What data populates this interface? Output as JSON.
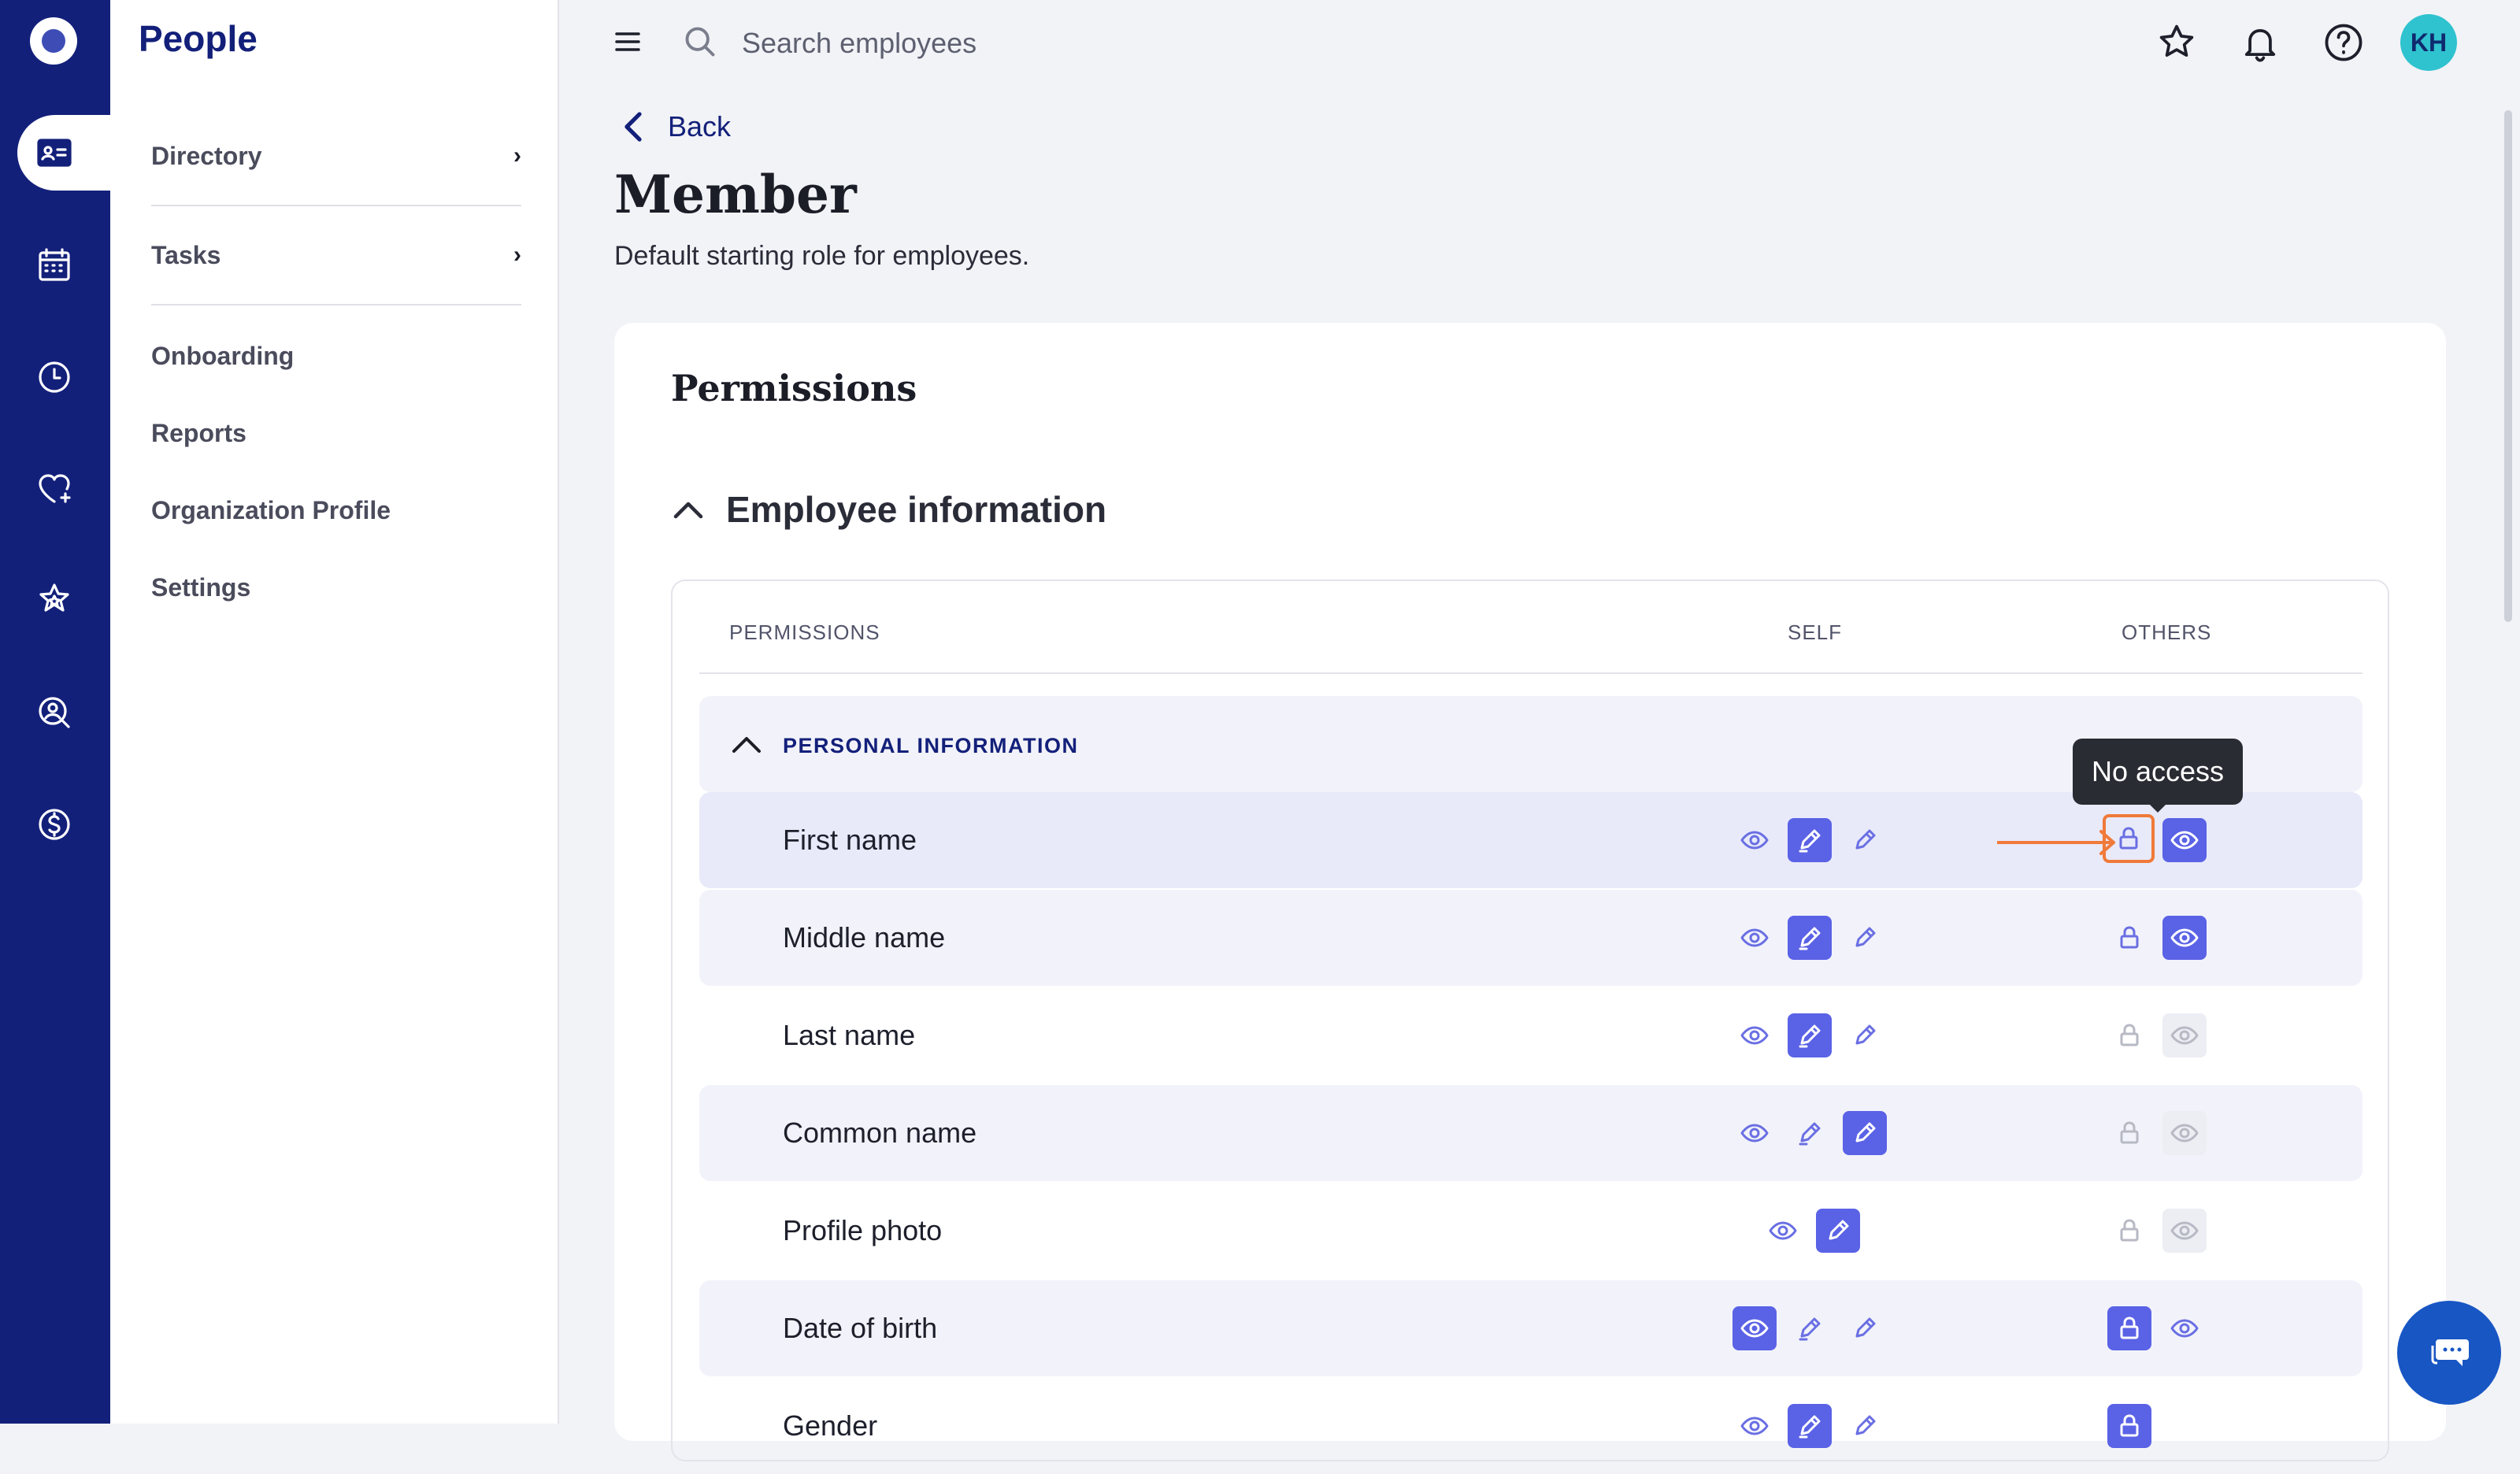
{
  "app": {
    "title": "People"
  },
  "sidebar": {
    "items": [
      {
        "label": "Directory",
        "chevron": true
      },
      {
        "label": "Tasks",
        "chevron": true
      },
      {
        "label": "Onboarding"
      },
      {
        "label": "Reports"
      },
      {
        "label": "Organization Profile"
      },
      {
        "label": "Settings"
      }
    ]
  },
  "rail": {
    "icons": [
      "directory-icon",
      "calendar-icon",
      "clock-icon",
      "heart-icon",
      "star-icon",
      "search-person-icon",
      "dollar-icon"
    ]
  },
  "topbar": {
    "search_placeholder": "Search employees",
    "avatar_initials": "KH"
  },
  "page": {
    "back_label": "Back",
    "title": "Member",
    "subtitle": "Default starting role for employees."
  },
  "permissions": {
    "heading": "Permissions",
    "section_title": "Employee information",
    "columns": {
      "permissions": "PERMISSIONS",
      "self": "SELF",
      "others": "OTHERS"
    },
    "group_title": "PERSONAL INFORMATION",
    "tooltip": "No access",
    "rows": [
      {
        "label": "First name",
        "self": "edit",
        "others": "view"
      },
      {
        "label": "Middle name",
        "self": "edit",
        "others": "view"
      },
      {
        "label": "Last name",
        "self": "edit",
        "others": "none"
      },
      {
        "label": "Common name",
        "self": "full",
        "others": "none"
      },
      {
        "label": "Profile photo",
        "self": "full",
        "others": "none"
      },
      {
        "label": "Date of birth",
        "self": "view",
        "others": "none"
      },
      {
        "label": "Gender",
        "self": "edit",
        "others": "none"
      }
    ]
  },
  "colors": {
    "rail": "#13207a",
    "accent": "#5a62e6",
    "highlight": "#f07a3a",
    "avatar": "#2fc2cf"
  }
}
